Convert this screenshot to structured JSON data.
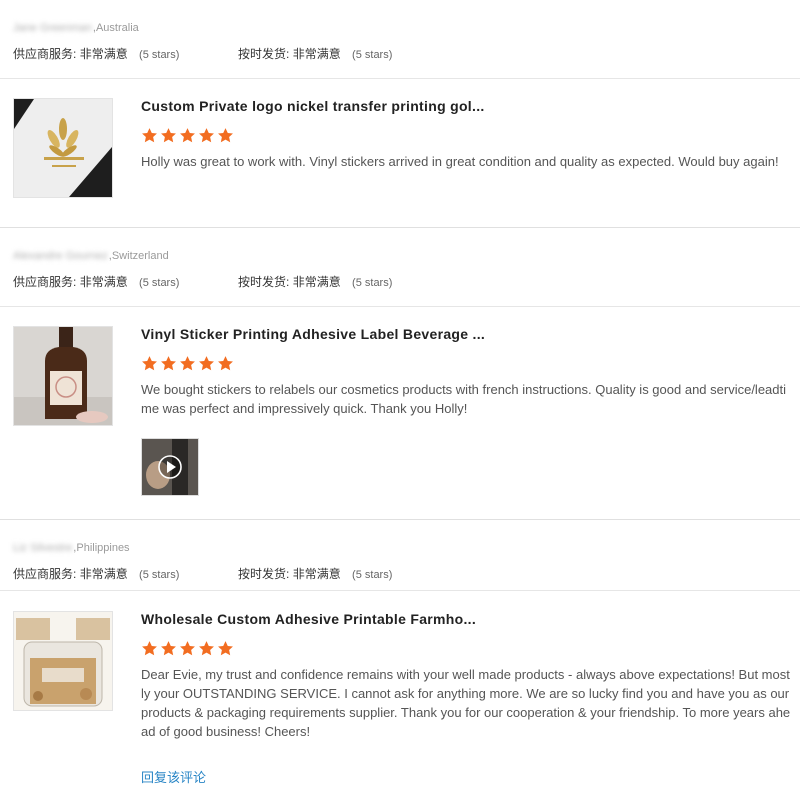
{
  "reviews": [
    {
      "reviewer_name": "Jane Greenman",
      "country": "Australia",
      "supplier_service_label": "供应商服务:",
      "supplier_service_value": "非常满意",
      "supplier_service_stars": "(5 stars)",
      "shipping_label": "按时发货:",
      "shipping_value": "非常满意",
      "shipping_stars": "(5 stars)",
      "product_title": "Custom Private logo nickel transfer printing gol...",
      "rating": 5,
      "text": "Holly was great to work with. Vinyl stickers arrived in great condition and quality as expected. Would buy again!"
    },
    {
      "reviewer_name": "Alexandre Gournez",
      "country": "Switzerland",
      "supplier_service_label": "供应商服务:",
      "supplier_service_value": "非常满意",
      "supplier_service_stars": "(5 stars)",
      "shipping_label": "按时发货:",
      "shipping_value": "非常满意",
      "shipping_stars": "(5 stars)",
      "product_title": "Vinyl Sticker Printing Adhesive Label Beverage ...",
      "rating": 5,
      "text": "We bought stickers to relabels our cosmetics products with french instructions. Quality is good and service/leadtime was perfect and impressively quick. Thank you Holly!"
    },
    {
      "reviewer_name": "Liz Silvestre",
      "country": "Philippines",
      "supplier_service_label": "供应商服务:",
      "supplier_service_value": "非常满意",
      "supplier_service_stars": "(5 stars)",
      "shipping_label": "按时发货:",
      "shipping_value": "非常满意",
      "shipping_stars": "(5 stars)",
      "product_title": "Wholesale Custom Adhesive Printable Farmho...",
      "rating": 5,
      "text": "Dear Evie, my trust and confidence remains with your well made products - always above expectations! But mostly your OUTSTANDING SERVICE. I cannot ask for anything more. We are so lucky find you and have you as our products & packaging requirements supplier. Thank you for our cooperation & your friendship. To more years ahead of good business! Cheers!",
      "reply_link": "回复该评论"
    }
  ],
  "colors": {
    "star": "#f26d21",
    "link": "#2a86c6"
  },
  "icons": {
    "rating_star": "star-icon",
    "video_play": "play-icon"
  }
}
